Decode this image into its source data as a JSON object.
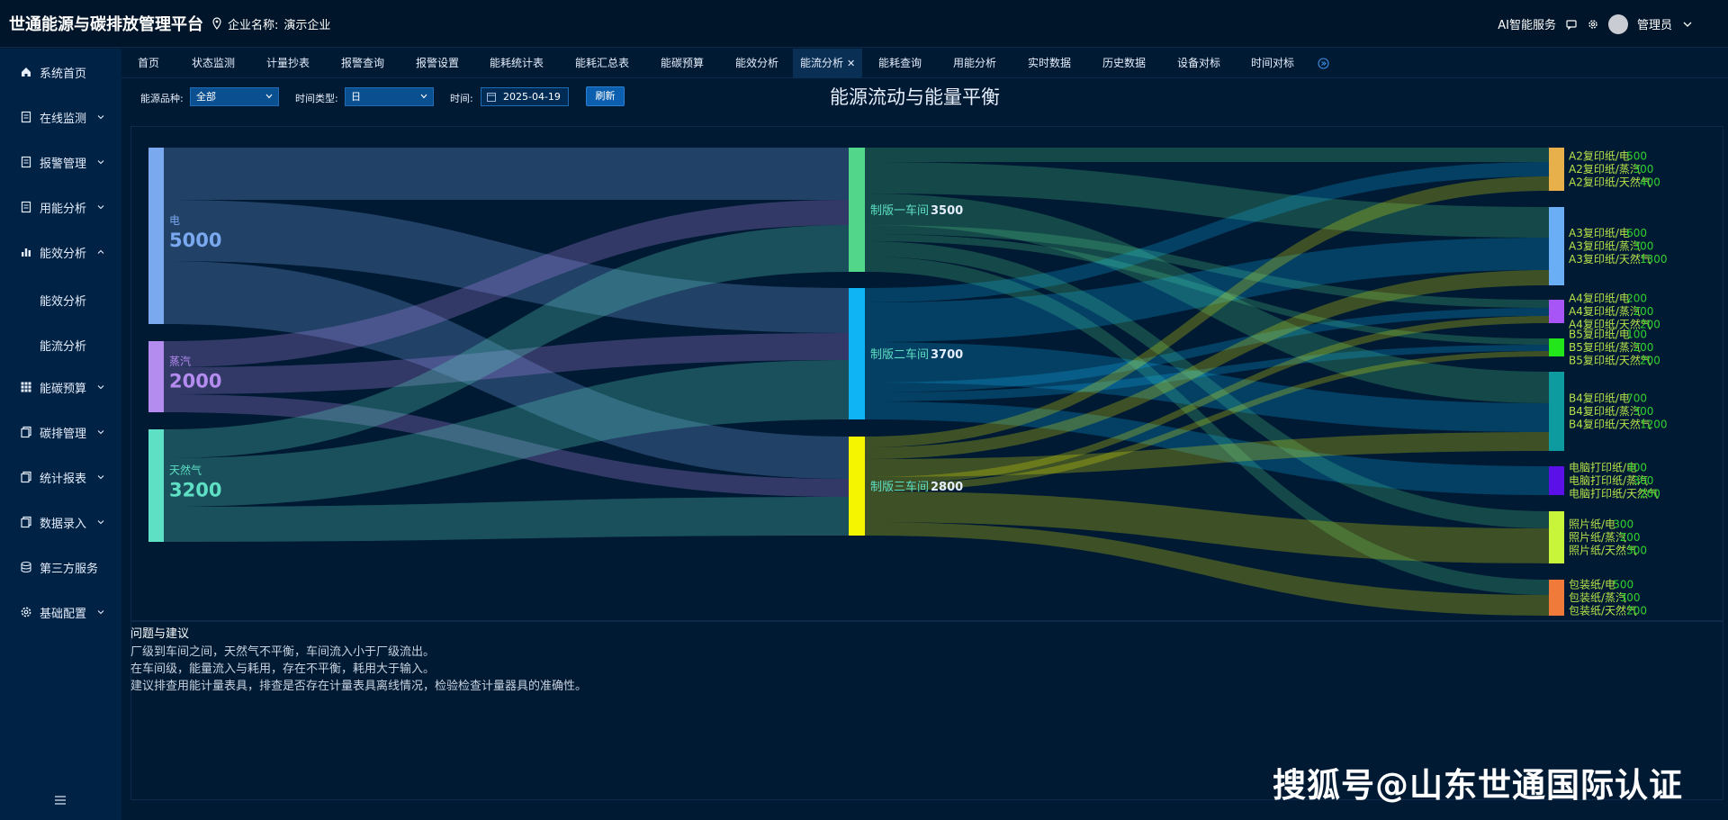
{
  "header": {
    "app_title": "世通能源与碳排放管理平台",
    "company_label": "企业名称:",
    "company_name": "演示企业",
    "ai_service": "AI智能服务",
    "user_name": "管理员"
  },
  "sidebar": {
    "items": [
      {
        "label": "系统首页",
        "icon": "home-icon"
      },
      {
        "label": "在线监测",
        "icon": "monitor-icon"
      },
      {
        "label": "报警管理",
        "icon": "alarm-icon"
      },
      {
        "label": "用能分析",
        "icon": "usage-icon"
      },
      {
        "label": "能效分析",
        "icon": "bar-chart-icon"
      },
      {
        "label": "能碳预算",
        "icon": "grid-icon"
      },
      {
        "label": "碳排管理",
        "icon": "carbon-icon"
      },
      {
        "label": "统计报表",
        "icon": "report-icon"
      },
      {
        "label": "数据录入",
        "icon": "input-icon"
      },
      {
        "label": "第三方服务",
        "icon": "database-icon"
      },
      {
        "label": "基础配置",
        "icon": "gear-icon"
      }
    ],
    "sub_items": [
      "能效分析",
      "能流分析"
    ]
  },
  "tabs": [
    "首页",
    "状态监测",
    "计量抄表",
    "报警查询",
    "报警设置",
    "能耗统计表",
    "能耗汇总表",
    "能碳预算",
    "能效分析",
    "能流分析",
    "能耗查询",
    "用能分析",
    "实时数据",
    "历史数据",
    "设备对标",
    "时间对标"
  ],
  "active_tab": "能流分析",
  "filters": {
    "energy_type_label": "能源品种:",
    "energy_type_value": "全部",
    "time_type_label": "时间类型:",
    "time_type_value": "日",
    "time_label": "时间:",
    "date_value": "2025-04-19",
    "refresh_label": "刷新"
  },
  "page_title": "能源流动与能量平衡",
  "chart_data": {
    "type": "sankey",
    "sources": [
      {
        "name": "电",
        "value": 5000,
        "color": "#7aa9f0"
      },
      {
        "name": "蒸汽",
        "value": 2000,
        "color": "#b48cf0"
      },
      {
        "name": "天然气",
        "value": 3200,
        "color": "#5ee0c4"
      }
    ],
    "workshops": [
      {
        "name": "制版一车间",
        "value": 3500,
        "color": "#52d68a"
      },
      {
        "name": "制版二车间",
        "value": 3700,
        "color": "#0fb4f5"
      },
      {
        "name": "制版三车间",
        "value": 2800,
        "color": "#f5f500"
      }
    ],
    "products": [
      {
        "name": "A2复印纸",
        "color": "#e8b04a",
        "lines": [
          [
            "A2复印纸/电",
            "500"
          ],
          [
            "A2复印纸/蒸汽",
            "300"
          ],
          [
            "A2复印纸/天然气",
            "400"
          ]
        ]
      },
      {
        "name": "A3复印纸",
        "color": "#6aaef5",
        "lines": [
          [
            "A3复印纸/电",
            "600"
          ],
          [
            "A3复印纸/蒸汽",
            "300"
          ],
          [
            "A3复印纸/天然气",
            "1300"
          ]
        ]
      },
      {
        "name": "A4复印纸",
        "color": "#a855f7",
        "lines": [
          [
            "A4复印纸/电",
            "200"
          ],
          [
            "A4复印纸/蒸汽",
            "200"
          ],
          [
            "A4复印纸/天然气",
            "200"
          ]
        ]
      },
      {
        "name": "B5复印纸",
        "color": "#22e61a",
        "lines": [
          [
            "B5复印纸/电",
            "100"
          ],
          [
            "B5复印纸/蒸汽",
            "200"
          ],
          [
            "B5复印纸/天然气",
            "200"
          ]
        ]
      },
      {
        "name": "B4复印纸",
        "color": "#0e9ba0",
        "lines": [
          [
            "B4复印纸/电",
            "700"
          ],
          [
            "B4复印纸/蒸汽",
            "300"
          ],
          [
            "B4复印纸/天然气",
            "1200"
          ]
        ]
      },
      {
        "name": "电脑打印纸",
        "color": "#5b10e8",
        "lines": [
          [
            "电脑打印纸/电",
            "300"
          ],
          [
            "电脑打印纸/蒸汽",
            "300"
          ],
          [
            "电脑打印纸/天然气",
            "200"
          ]
        ]
      },
      {
        "name": "照片纸",
        "color": "#c8f53a",
        "lines": [
          [
            "照片纸/电",
            "300"
          ],
          [
            "照片纸/蒸汽",
            "200"
          ],
          [
            "照片纸/天然气",
            "300"
          ]
        ]
      },
      {
        "name": "包装纸",
        "color": "#f07a3a",
        "lines": [
          [
            "包装纸/电",
            "500"
          ],
          [
            "包装纸/蒸汽",
            "300"
          ],
          [
            "包装纸/天然气",
            "200"
          ]
        ]
      }
    ]
  },
  "suggestions": {
    "title": "问题与建议",
    "lines": [
      "厂级到车间之间，天然气不平衡，车间流入小于厂级流出。",
      "在车间级，能量流入与耗用，存在不平衡，耗用大于输入。",
      "建议排查用能计量表具，排查是否存在计量表具离线情况，检验检查计量器具的准确性。"
    ]
  },
  "watermark": "搜狐号@山东世通国际认证"
}
